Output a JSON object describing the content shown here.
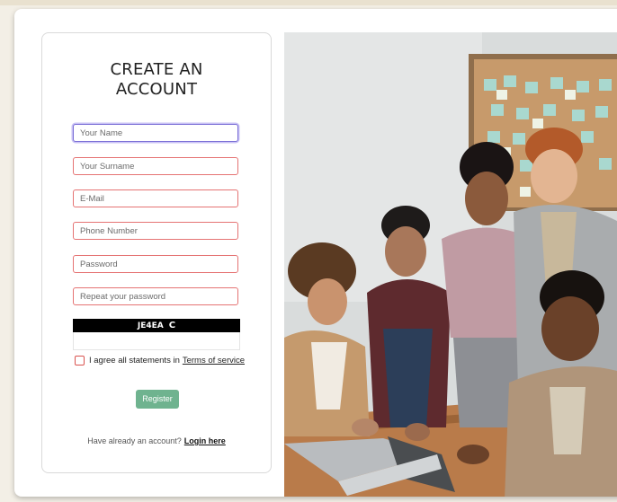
{
  "form": {
    "title_line1": "CREATE AN",
    "title_line2": "ACCOUNT",
    "fields": [
      {
        "placeholder": "Your Name",
        "value": ""
      },
      {
        "placeholder": "Your Surname",
        "value": ""
      },
      {
        "placeholder": "E-Mail",
        "value": ""
      },
      {
        "placeholder": "Phone Number",
        "value": ""
      },
      {
        "placeholder": "Password",
        "value": ""
      },
      {
        "placeholder": "Repeat your password",
        "value": ""
      }
    ],
    "captcha": {
      "code": "JE4EA",
      "refresh_glyph": "C",
      "value": ""
    },
    "agree": {
      "text": "I agree all statements in",
      "link_text": "Terms of service",
      "checked": false
    },
    "register_label": "Register",
    "login_prompt": "Have already an account?",
    "login_link": "Login here"
  },
  "colors": {
    "accent_green": "#6fb38f",
    "field_border": "#e57373",
    "focus_border": "#7b6fd6",
    "captcha_bg": "#000000"
  },
  "image": {
    "subject": "group of five people gathered around a laptop at a wooden table, corkboard with sticky notes behind"
  }
}
